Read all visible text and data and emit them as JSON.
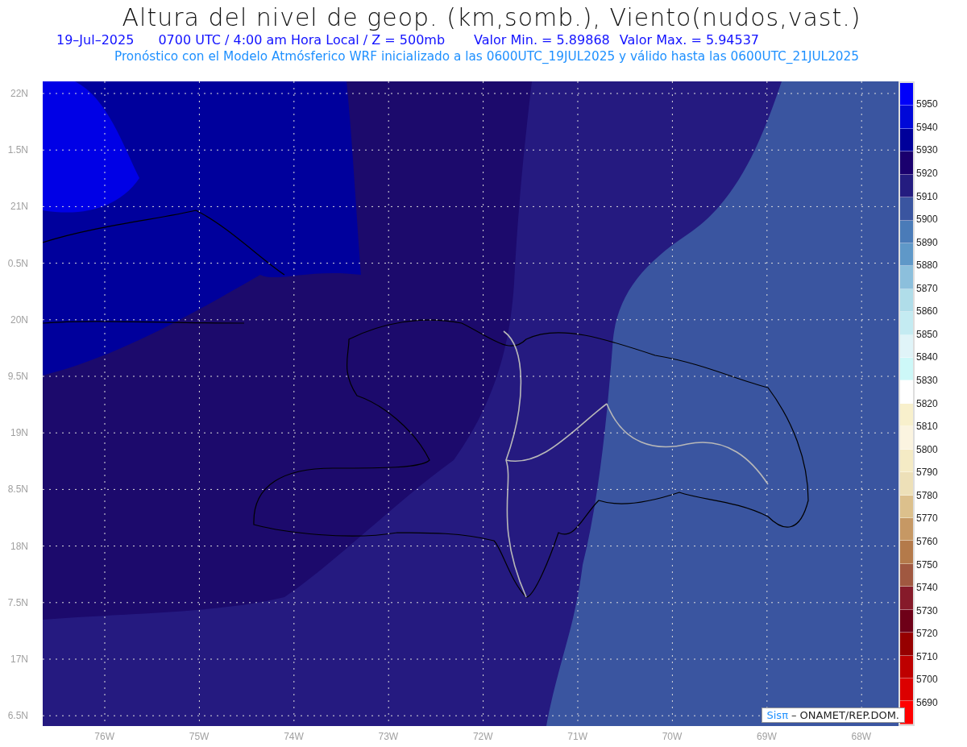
{
  "title": "Altura del nivel de geop. (km,somb.), Viento(nudos,vast.)",
  "info_line": {
    "date": "19–Jul–2025",
    "time": "0700 UTC / 4:00 am Hora Local / Z = 500mb",
    "min": "Valor Min. = 5.89868",
    "max": "Valor Max. = 5.94537"
  },
  "model_line": "Pronóstico con el Modelo Atmósferico WRF inicializado a las 0600UTC_19JUL2025 y válido hasta las  0600UTC_21JUL2025",
  "map": {
    "lat_labels": [
      "22N",
      "1.5N",
      "21N",
      "0.5N",
      "20N",
      "9.5N",
      "19N",
      "8.5N",
      "18N",
      "7.5N",
      "17N",
      "6.5N"
    ],
    "lon_labels": [
      "76W",
      "75W",
      "74W",
      "73W",
      "72W",
      "71W",
      "70W",
      "69W",
      "68W"
    ],
    "credit": {
      "brand": "Sisπ",
      "text": "– ONAMET/REP.DOM."
    }
  },
  "colorbar": {
    "bins": [
      {
        "color": "#0000fa"
      },
      {
        "color": "#0008d8"
      },
      {
        "color": "#00009a"
      },
      {
        "color": "#1a006e"
      },
      {
        "color": "#241c80"
      },
      {
        "color": "#3a55a0"
      },
      {
        "color": "#4a7bb8"
      },
      {
        "color": "#5f98c8"
      },
      {
        "color": "#8cbfdc"
      },
      {
        "color": "#b0dde9"
      },
      {
        "color": "#c4ebf2"
      },
      {
        "color": "#e0f4f8"
      },
      {
        "color": "#cdf8f8"
      },
      {
        "color": "#ffffff"
      },
      {
        "color": "#f8f0cc"
      },
      {
        "color": "#fbf4e0"
      },
      {
        "color": "#f5ebc5"
      },
      {
        "color": "#ede0b8"
      },
      {
        "color": "#dcc08c"
      },
      {
        "color": "#c69864"
      },
      {
        "color": "#b47a4a"
      },
      {
        "color": "#a05840"
      },
      {
        "color": "#861a2a"
      },
      {
        "color": "#6e0018"
      },
      {
        "color": "#960000"
      },
      {
        "color": "#be0000"
      },
      {
        "color": "#dc0000"
      },
      {
        "color": "#ff0000"
      }
    ],
    "labels": [
      "5950",
      "5940",
      "5930",
      "5920",
      "5910",
      "5900",
      "5890",
      "5880",
      "5870",
      "5860",
      "5850",
      "5840",
      "5830",
      "5820",
      "5810",
      "5800",
      "5790",
      "5780",
      "5770",
      "5760",
      "5750",
      "5740",
      "5730",
      "5720",
      "5710",
      "5700",
      "5690"
    ]
  }
}
